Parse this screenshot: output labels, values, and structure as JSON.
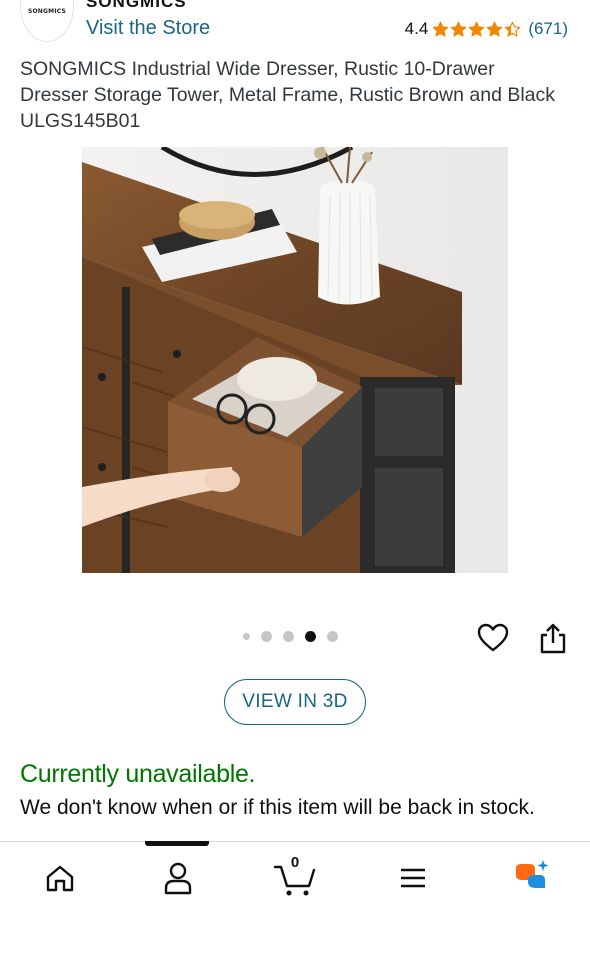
{
  "store": {
    "logo_text": "SONGMICS",
    "brand_name": "SONGMICS",
    "visit_label": "Visit the Store"
  },
  "rating": {
    "value": "4.4",
    "stars": 4.4,
    "count": "(671)",
    "star_color": "#f08804"
  },
  "product": {
    "title": "SONGMICS Industrial Wide Dresser, Rustic 10-Drawer Dresser Storage Tower, Metal Frame, Rustic Brown and Black ULGS145B01"
  },
  "carousel": {
    "total": 5,
    "active_index": 3
  },
  "actions": {
    "view_3d_label": "VIEW IN 3D"
  },
  "availability": {
    "status": "Currently unavailable.",
    "message": "We don't know when or if this item will be back in stock."
  },
  "bottom_nav": {
    "items": [
      {
        "name": "home",
        "icon": "home-icon"
      },
      {
        "name": "account",
        "icon": "person-icon"
      },
      {
        "name": "cart",
        "icon": "cart-icon",
        "count": "0"
      },
      {
        "name": "menu",
        "icon": "menu-icon"
      },
      {
        "name": "rufus",
        "icon": "rufus-icon"
      }
    ],
    "active": "account"
  },
  "colors": {
    "link": "#1a6585",
    "available_green": "#007600",
    "text": "#0f1111"
  }
}
